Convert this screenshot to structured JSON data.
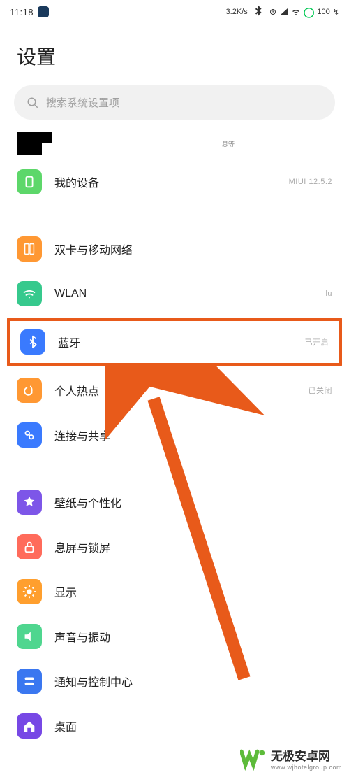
{
  "status": {
    "time": "11:18",
    "net": "3.2K/s",
    "battery": "100"
  },
  "header": {
    "title": "设置"
  },
  "search": {
    "placeholder": "搜索系统设置项"
  },
  "account": {
    "badge": "息等"
  },
  "items": {
    "device": {
      "label": "我的设备",
      "trail": "MIUI 12.5.2"
    },
    "sim": {
      "label": "双卡与移动网络"
    },
    "wlan": {
      "label": "WLAN",
      "trail": "lu"
    },
    "bt": {
      "label": "蓝牙",
      "trail": "已开启"
    },
    "hotspot": {
      "label": "个人热点",
      "trail": "已关闭"
    },
    "share": {
      "label": "连接与共享"
    },
    "wall": {
      "label": "壁纸与个性化"
    },
    "lock": {
      "label": "息屏与锁屏"
    },
    "display": {
      "label": "显示"
    },
    "sound": {
      "label": "声音与振动"
    },
    "notif": {
      "label": "通知与控制中心"
    },
    "home": {
      "label": "桌面"
    }
  },
  "watermark": {
    "text": "无极安卓网",
    "url": "www.wjhotelgroup.com"
  }
}
